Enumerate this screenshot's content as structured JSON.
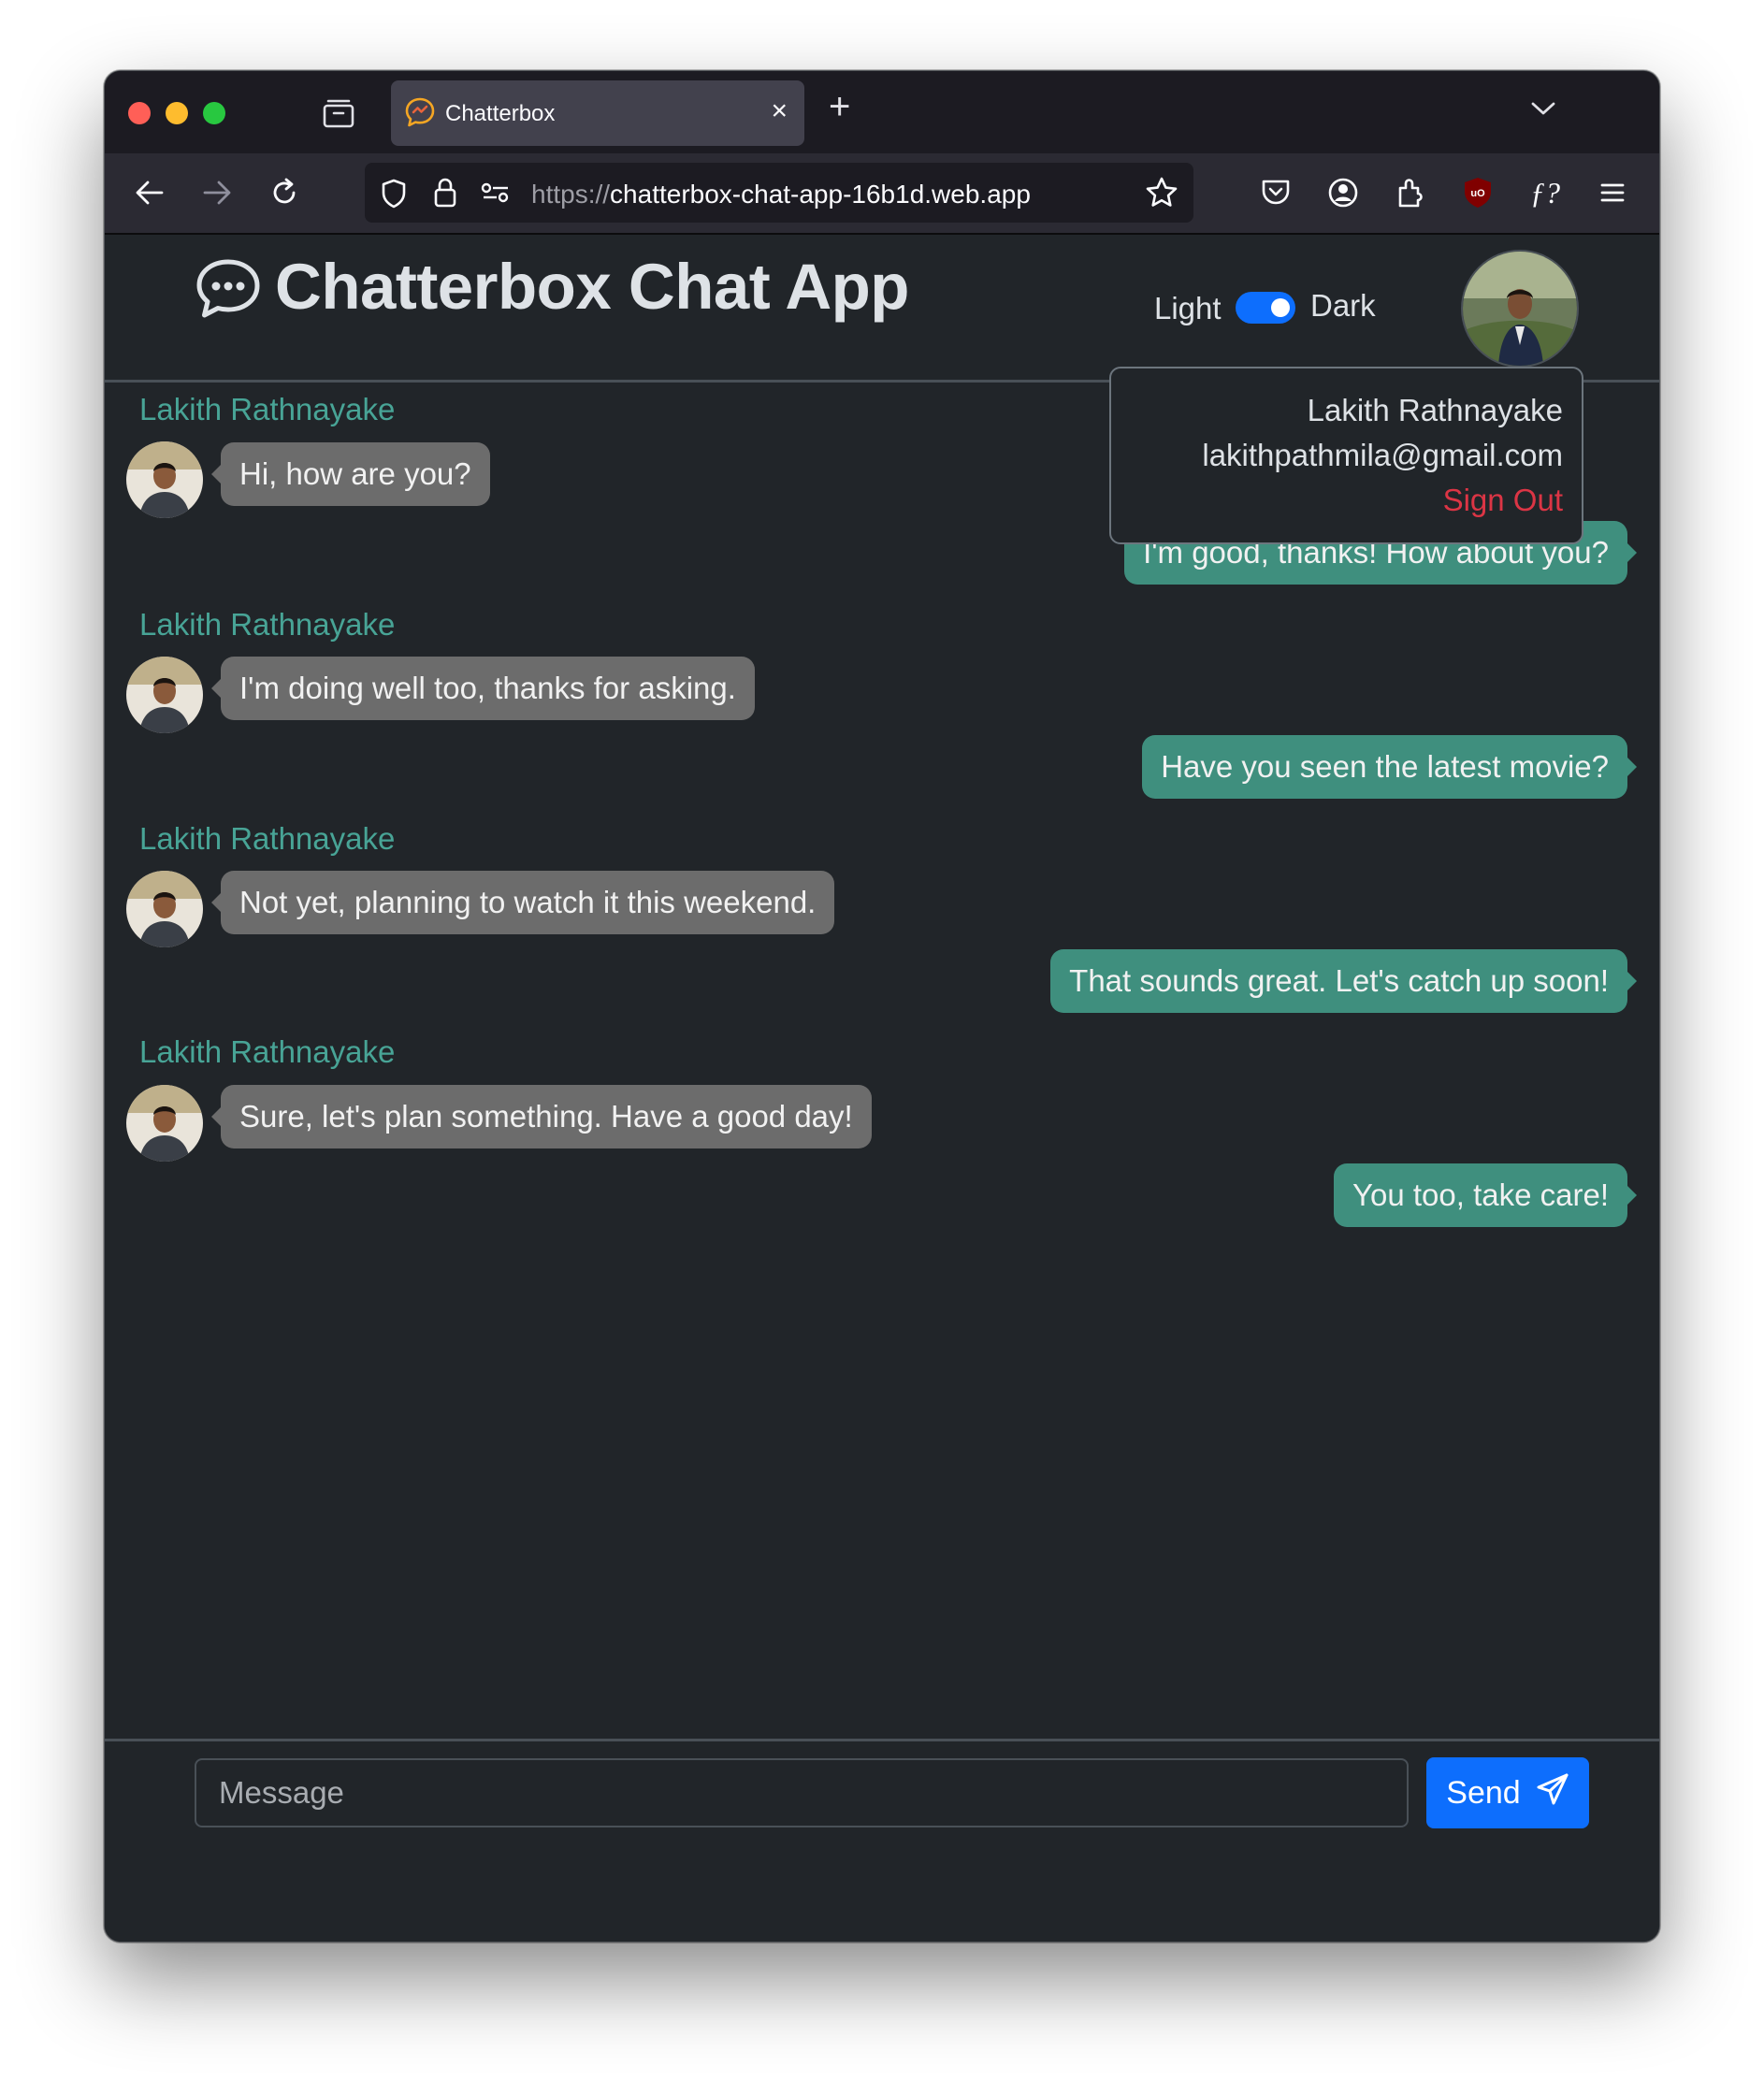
{
  "browser": {
    "tab_title": "Chatterbox",
    "tab_close_glyph": "×",
    "new_tab_glyph": "+",
    "url_scheme": "https://",
    "url_host": "chatterbox-chat-app-16b1d.web.app",
    "extension_font_label": "ƒ?",
    "ublock_label": "uO"
  },
  "header": {
    "title": "Chatterbox Chat App",
    "theme_light_label": "Light",
    "theme_dark_label": "Dark",
    "theme_is_dark": true
  },
  "profile_popup": {
    "name": "Lakith Rathnayake",
    "email": "lakithpathmila@gmail.com",
    "sign_out_label": "Sign Out"
  },
  "messages": [
    {
      "sender": "Lakith Rathnayake",
      "text": "Hi, how are you?",
      "incoming": true
    },
    {
      "text": "I'm good, thanks! How about you?",
      "incoming": false
    },
    {
      "sender": "Lakith Rathnayake",
      "text": "I'm doing well too, thanks for asking.",
      "incoming": true
    },
    {
      "text": "Have you seen the latest movie?",
      "incoming": false
    },
    {
      "sender": "Lakith Rathnayake",
      "text": "Not yet, planning to watch it this weekend.",
      "incoming": true
    },
    {
      "text": "That sounds great. Let's catch up soon!",
      "incoming": false
    },
    {
      "sender": "Lakith Rathnayake",
      "text": "Sure, let's plan something. Have a good day!",
      "incoming": true
    },
    {
      "text": "You too, take care!",
      "incoming": false
    }
  ],
  "composer": {
    "placeholder": "Message",
    "send_label": "Send"
  },
  "colors": {
    "app_background": "#212529",
    "incoming_bubble": "#6c6c6c",
    "outgoing_bubble": "#3f8f7e",
    "sender_name": "#48a496",
    "accent": "#0d6efd",
    "sign_out": "#dc3545"
  }
}
